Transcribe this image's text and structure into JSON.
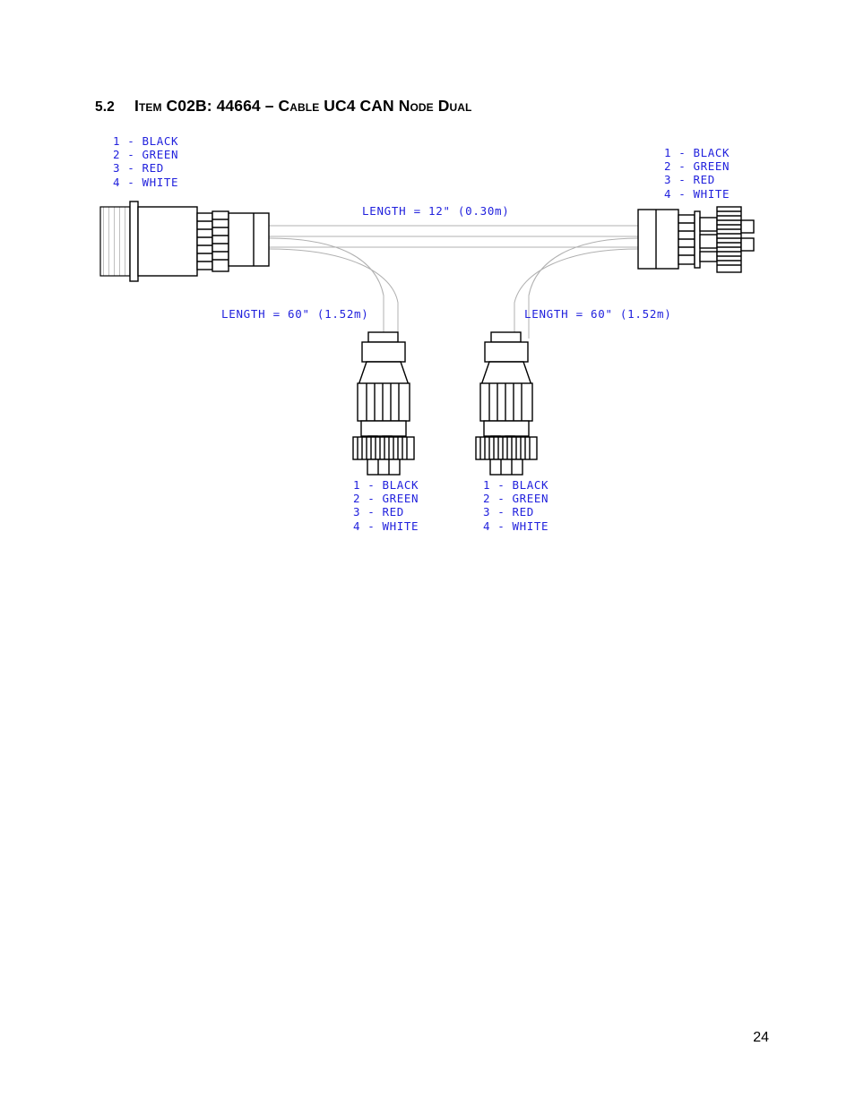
{
  "document": {
    "page_number": "24"
  },
  "heading": {
    "number": "5.2",
    "title": "Item C02B: 44664 – Cable UC4 CAN Node Dual"
  },
  "diagram": {
    "pin_legend_top_left": "1 - BLACK\n2 - GREEN\n3 - RED\n4 - WHITE",
    "pin_legend_top_right": "1 - BLACK\n2 - GREEN\n3 - RED\n4 - WHITE",
    "pin_legend_bottom_left": "1 - BLACK\n2 - GREEN\n3 - RED\n4 - WHITE",
    "pin_legend_bottom_right": "1 - BLACK\n2 - GREEN\n3 - RED\n4 - WHITE",
    "length_trunk": "LENGTH = 12\" (0.30m)",
    "length_branch_left": "LENGTH = 60\" (1.52m)",
    "length_branch_right": "LENGTH = 60\" (1.52m)",
    "colors": {
      "annotation_blue": "#2222dd",
      "line_black": "#000000",
      "cable_gray": "#aaaaaa",
      "hatch_gray": "#bbbbbb"
    }
  }
}
